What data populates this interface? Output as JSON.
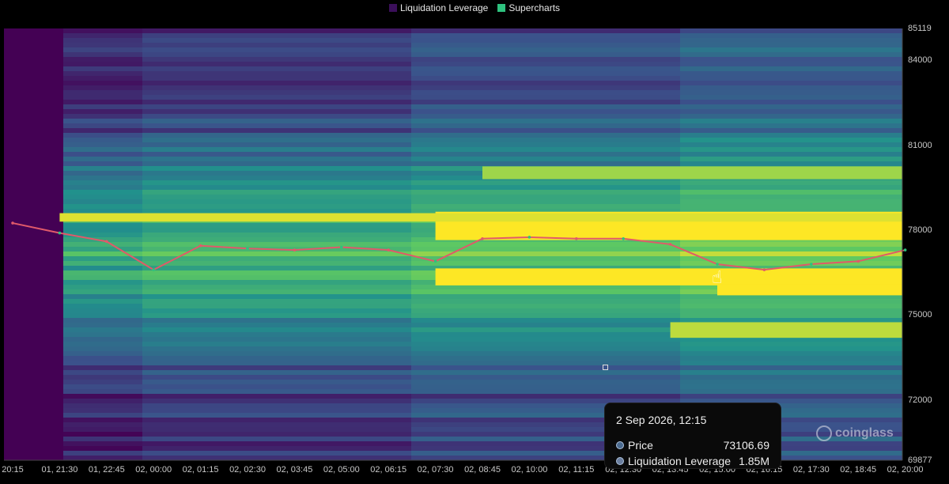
{
  "legend": {
    "items": [
      {
        "label": "Liquidation Leverage",
        "color": "#3b0f5a"
      },
      {
        "label": "Supercharts",
        "color": "#2ec27e"
      }
    ]
  },
  "chart_data": {
    "type": "heatmap",
    "title": "",
    "y_axis": {
      "range": [
        69877,
        85119
      ],
      "ticks": [
        "85119",
        "84000",
        "81000",
        "78000",
        "75000",
        "72000",
        "69877"
      ]
    },
    "x_axis": {
      "ticks": [
        "20:15",
        "01, 21:30",
        "01, 22:45",
        "02, 00:00",
        "02, 01:15",
        "02, 02:30",
        "02, 03:45",
        "02, 05:00",
        "02, 06:15",
        "02, 07:30",
        "02, 08:45",
        "02, 10:00",
        "02, 11:15",
        "02, 12:30",
        "02, 13:45",
        "02, 15:00",
        "02, 16:15",
        "02, 17:30",
        "02, 18:45",
        "02, 20:00"
      ]
    },
    "colorscale": [
      "#440154",
      "#3b528b",
      "#21918c",
      "#5ec962",
      "#fde725"
    ],
    "price_series": {
      "name": "Price",
      "x": [
        "20:15",
        "01, 21:30",
        "01, 22:45",
        "02, 00:00",
        "02, 01:15",
        "02, 02:30",
        "02, 03:45",
        "02, 05:00",
        "02, 06:15",
        "02, 07:30",
        "02, 08:45",
        "02, 10:00",
        "02, 11:15",
        "02, 12:30",
        "02, 13:45",
        "02, 15:00",
        "02, 16:15",
        "02, 17:30",
        "02, 18:45",
        "02, 20:00"
      ],
      "values": [
        78250,
        77900,
        77600,
        76600,
        77450,
        77350,
        77300,
        77400,
        77300,
        76900,
        77700,
        77750,
        77700,
        77700,
        77500,
        76800,
        76600,
        76800,
        76900,
        77300
      ]
    },
    "bands": [
      {
        "from": 77650,
        "to": 78650,
        "start": "02, 07:30",
        "level": 1.0
      },
      {
        "from": 76050,
        "to": 76650,
        "start": "02, 07:30",
        "level": 1.0
      },
      {
        "from": 75700,
        "to": 76100,
        "start": "02, 15:00",
        "level": 1.0
      },
      {
        "from": 79800,
        "to": 80250,
        "start": "02, 08:45",
        "level": 0.85
      },
      {
        "from": 74200,
        "to": 74750,
        "start": "02, 13:45",
        "level": 0.9
      },
      {
        "from": 78300,
        "to": 78600,
        "start": "01, 21:30",
        "level": 0.95
      }
    ]
  },
  "tooltip": {
    "title": "2 Sep 2026, 12:15",
    "rows": [
      {
        "label": "Price",
        "value": "73106.69"
      },
      {
        "label": "Liquidation Leverage",
        "value": "1.85M"
      }
    ]
  },
  "watermark": {
    "text": "coinglass"
  }
}
